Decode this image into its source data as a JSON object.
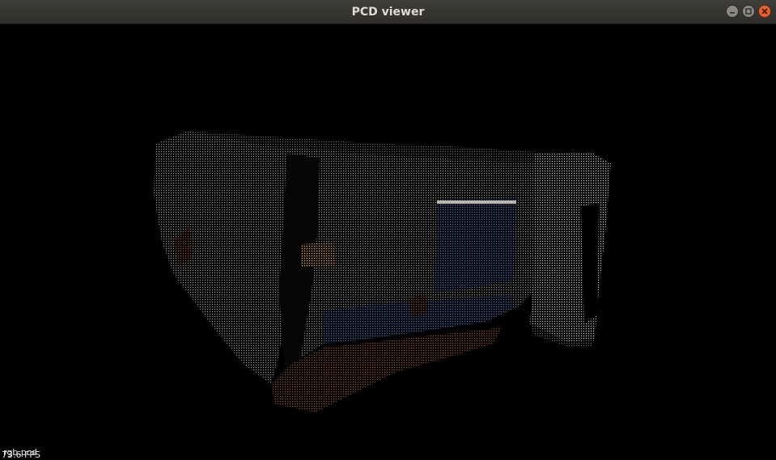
{
  "window": {
    "title": "PCD viewer"
  },
  "controls": {
    "minimize_icon": "minimize-icon",
    "maximize_icon": "maximize-icon",
    "close_icon": "close-icon"
  },
  "viewer": {
    "background": "#000000",
    "fps_text": "73.6 FPS",
    "file_label": "rgb.pcd"
  }
}
